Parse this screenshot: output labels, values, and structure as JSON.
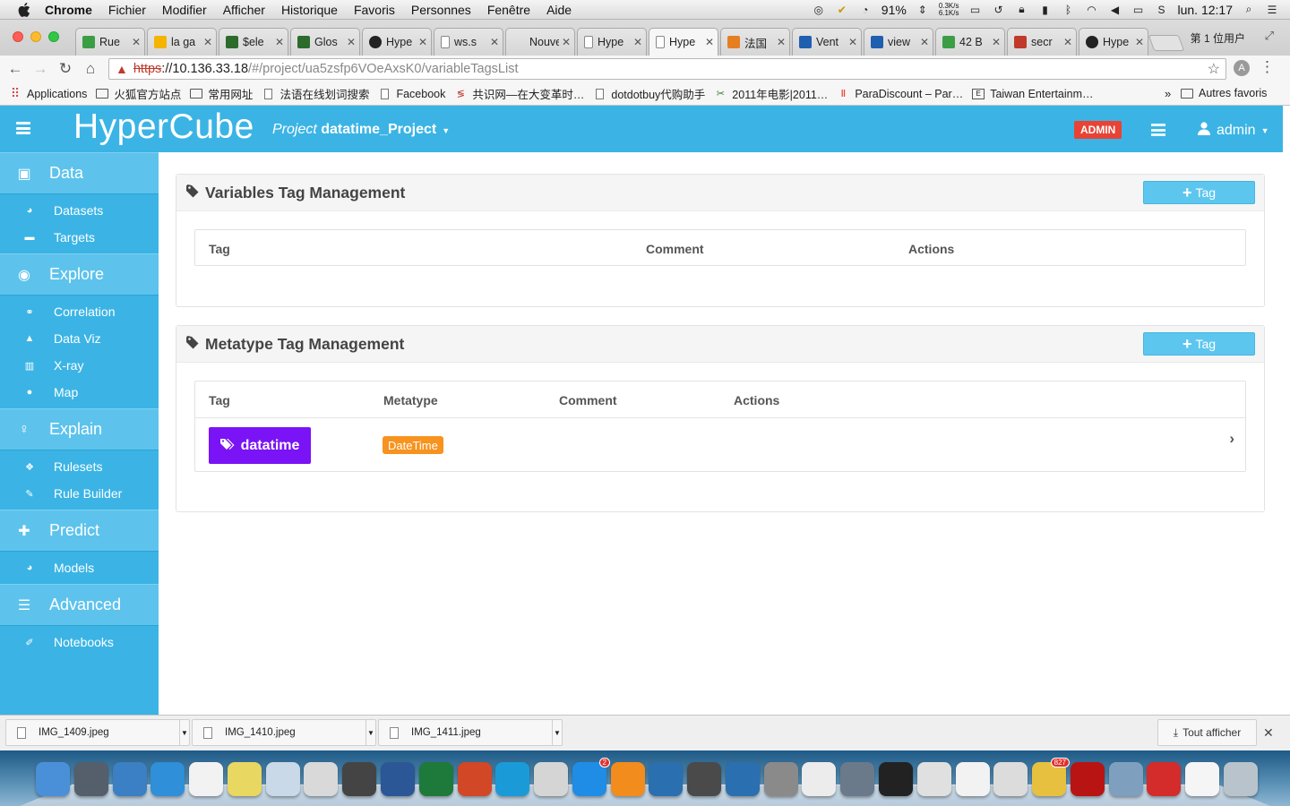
{
  "menubar": {
    "app_name": "Chrome",
    "items": [
      "Fichier",
      "Modifier",
      "Afficher",
      "Historique",
      "Favoris",
      "Personnes",
      "Fenêtre",
      "Aide"
    ],
    "battery": "91%",
    "net_up": "0.3K/s",
    "net_down": "6.1K/s",
    "clock": "lun. 12:17"
  },
  "browser": {
    "tabs": [
      {
        "title": "Rue",
        "icon": "maps-icon",
        "color": "#3b9e44"
      },
      {
        "title": "la ga",
        "icon": "drive-icon",
        "color": "#f4b400"
      },
      {
        "title": "$ele",
        "icon": "leaf-icon",
        "color": "#2d6b2d"
      },
      {
        "title": "Glos",
        "icon": "leaf-icon",
        "color": "#2d6b2d"
      },
      {
        "title": "Hype",
        "icon": "github-icon",
        "color": "#222222"
      },
      {
        "title": "ws.s",
        "icon": "page-icon",
        "color": "#999999"
      },
      {
        "title": "Nouvel",
        "icon": "none",
        "color": "#dddddd"
      },
      {
        "title": "Hype",
        "icon": "page-icon",
        "color": "#999999"
      },
      {
        "title": "Hype",
        "icon": "page-icon",
        "color": "#999999",
        "active": true
      },
      {
        "title": "法国",
        "icon": "search-icon",
        "color": "#e67e22"
      },
      {
        "title": "Vent",
        "icon": "pap-icon",
        "color": "#1f5fb0"
      },
      {
        "title": "view",
        "icon": "pap-icon",
        "color": "#1f5fb0"
      },
      {
        "title": "42 B",
        "icon": "maps-icon",
        "color": "#3b9e44"
      },
      {
        "title": "secr",
        "icon": "flag-icon",
        "color": "#c0392b"
      },
      {
        "title": "Hype",
        "icon": "github-icon",
        "color": "#222222"
      }
    ],
    "profile": "第 1 位用户",
    "url_scheme": "https",
    "url_host": "://10.136.33.18",
    "url_path": "/#/project/ua5zsfp6VOeAxsK0/variableTagsList",
    "bookmarks": [
      {
        "label": "Applications",
        "icon": "apps-grid-icon"
      },
      {
        "label": "火狐官方站点",
        "icon": "folder-icon"
      },
      {
        "label": "常用网址",
        "icon": "folder-icon"
      },
      {
        "label": "法语在线划词搜索",
        "icon": "page-icon"
      },
      {
        "label": "Facebook",
        "icon": "page-icon"
      },
      {
        "label": "共识网—在大变革时…",
        "icon": "logo-icon"
      },
      {
        "label": "dotdotbuy代购助手",
        "icon": "page-icon"
      },
      {
        "label": "2011年电影|2011…",
        "icon": "film-icon"
      },
      {
        "label": "ParaDiscount – Par…",
        "icon": "pharmacy-icon"
      },
      {
        "label": "Taiwan Entertainm…",
        "icon": "news-icon"
      }
    ],
    "bookmarks_more": "»",
    "bookmarks_other": "Autres favoris"
  },
  "app": {
    "brand": "HyperCube",
    "project_prefix": "Project",
    "project_name": "datatime_Project",
    "admin_badge": "ADMIN",
    "user": "admin",
    "colors": {
      "primary": "#3bb4e5",
      "section": "#5dc3ec",
      "tag_purple": "#7a13f5",
      "metatype_orange": "#f7931e",
      "admin_red": "#e84335"
    }
  },
  "sidebar": {
    "sections": [
      {
        "label": "Data",
        "icon": "archive-icon",
        "items": [
          {
            "label": "Datasets",
            "icon": "dashboard-icon"
          },
          {
            "label": "Targets",
            "icon": "briefcase-icon"
          }
        ]
      },
      {
        "label": "Explore",
        "icon": "eye-icon",
        "items": [
          {
            "label": "Correlation",
            "icon": "link-icon"
          },
          {
            "label": "Data Viz",
            "icon": "area-chart-icon"
          },
          {
            "label": "X-ray",
            "icon": "bar-chart-icon"
          },
          {
            "label": "Map",
            "icon": "globe-icon"
          }
        ]
      },
      {
        "label": "Explain",
        "icon": "lightbulb-icon",
        "items": [
          {
            "label": "Rulesets",
            "icon": "cubes-icon"
          },
          {
            "label": "Rule Builder",
            "icon": "wrench-icon"
          }
        ]
      },
      {
        "label": "Predict",
        "icon": "puzzle-icon",
        "items": [
          {
            "label": "Models",
            "icon": "dashboard-icon"
          }
        ]
      },
      {
        "label": "Advanced",
        "icon": "sliders-icon",
        "items": [
          {
            "label": "Notebooks",
            "icon": "edit-icon"
          }
        ]
      }
    ]
  },
  "variables_panel": {
    "title": "Variables Tag Management",
    "add_label": "Tag",
    "columns": [
      "Tag",
      "Comment",
      "Actions"
    ],
    "rows": []
  },
  "metatype_panel": {
    "title": "Metatype Tag Management",
    "add_label": "Tag",
    "columns": [
      "Tag",
      "Metatype",
      "Comment",
      "Actions"
    ],
    "rows": [
      {
        "tag": "datatime",
        "metatype": "DateTime",
        "comment": ""
      }
    ]
  },
  "downloads": {
    "files": [
      "IMG_1409.jpeg",
      "IMG_1410.jpeg",
      "IMG_1411.jpeg"
    ],
    "show_all": "Tout afficher"
  },
  "dock": {
    "apps": [
      {
        "name": "finder-icon",
        "color": "#4a90d9"
      },
      {
        "name": "launchpad-icon",
        "color": "#555e6b"
      },
      {
        "name": "mail-bird-icon",
        "color": "#3b7fc4"
      },
      {
        "name": "safari-icon",
        "color": "#2f8fd8"
      },
      {
        "name": "apps-grid-icon",
        "color": "#f2f2f2"
      },
      {
        "name": "stickies-icon",
        "color": "#e8d760"
      },
      {
        "name": "preview-icon",
        "color": "#c9d9e8"
      },
      {
        "name": "office-icon",
        "color": "#d9d9d9"
      },
      {
        "name": "photo-booth-icon",
        "color": "#444444"
      },
      {
        "name": "word-icon",
        "color": "#2b5797"
      },
      {
        "name": "excel-icon",
        "color": "#1d7a3a"
      },
      {
        "name": "powerpoint-icon",
        "color": "#d24726"
      },
      {
        "name": "lync-icon",
        "color": "#1a9bd7"
      },
      {
        "name": "scissors-icon",
        "color": "#d5d5d5"
      },
      {
        "name": "app-store-icon",
        "color": "#1f8ce6",
        "badge": "2"
      },
      {
        "name": "ibooks-icon",
        "color": "#f28c1c"
      },
      {
        "name": "vpn-icon",
        "color": "#2a6fb0"
      },
      {
        "name": "sublime-icon",
        "color": "#4a4a4a"
      },
      {
        "name": "sap-icon",
        "color": "#2a6fb0"
      },
      {
        "name": "system-prefs-icon",
        "color": "#8a8a8a"
      },
      {
        "name": "wechat-icon",
        "color": "#ececec"
      },
      {
        "name": "clock-icon",
        "color": "#6a7a8a"
      },
      {
        "name": "terminal-icon",
        "color": "#222222"
      },
      {
        "name": "chrome-icon",
        "color": "#e0e0e0"
      },
      {
        "name": "itunes-icon",
        "color": "#f2f2f2"
      },
      {
        "name": "printer-icon",
        "color": "#dcdcdc"
      },
      {
        "name": "messages-icon",
        "color": "#e8c040",
        "badge": "827"
      },
      {
        "name": "acrobat-icon",
        "color": "#b81414"
      },
      {
        "name": "image-capture-icon",
        "color": "#7f9fbf"
      },
      {
        "name": "remote-desktop-icon",
        "color": "#d42b2b"
      },
      {
        "name": "document-icon",
        "color": "#f5f5f5"
      },
      {
        "name": "trash-icon",
        "color": "#b9c3cc"
      }
    ]
  }
}
